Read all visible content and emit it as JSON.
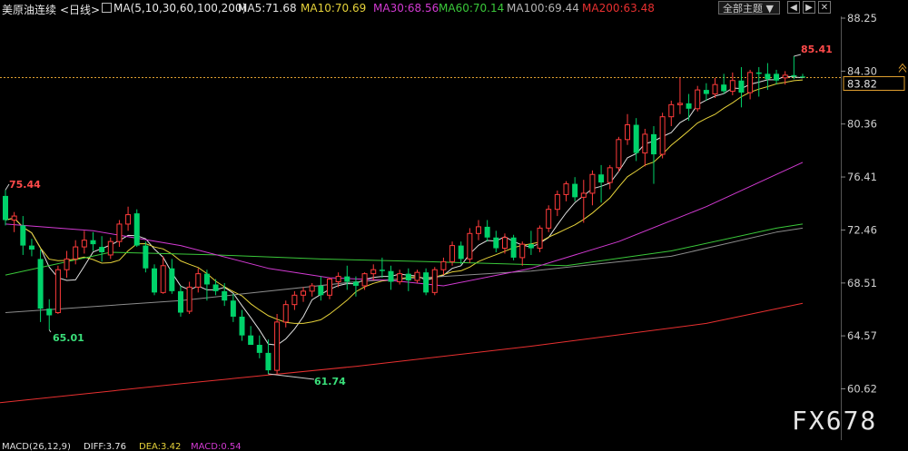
{
  "header": {
    "symbol": "美原油连续",
    "period": "<日线>",
    "indicator_name": "MA(5,10,30,60,100,200)",
    "ma5": "MA5:71.68",
    "ma10": "MA10:70.69",
    "ma30": "MA30:68.56",
    "ma60": "MA60:70.14",
    "ma100": "MA100:69.44",
    "ma200": "MA200:63.48",
    "theme_button": "全部主题 ▼",
    "btn_left": "◀",
    "btn_right": "▶",
    "btn_close": "✕"
  },
  "price_axis": {
    "ticks": [
      "88.25",
      "84.30",
      "80.36",
      "76.41",
      "72.46",
      "68.51",
      "64.57",
      "60.62"
    ],
    "current_price": "83.82"
  },
  "annotations": {
    "high_left": "75.44",
    "low_left": "65.01",
    "low_mid": "61.74",
    "high_right": "85.41"
  },
  "watermark": "FX678",
  "bottom": {
    "macd": "MACD(26,12,9)",
    "diff": "DIFF:3.76",
    "dea": "DEA:3.42",
    "macd_val": "MACD:0.54"
  },
  "colors": {
    "up": "#ff3b3b",
    "down": "#00d26a",
    "ma5": "#e0e0e0",
    "ma10": "#e6d23a",
    "ma30": "#d23ad2",
    "ma60": "#3ac83a",
    "ma100": "#8c8c8c",
    "ma200": "#e83030"
  },
  "chart_data": {
    "type": "candlestick",
    "y_ticks": [
      88.25,
      84.3,
      80.36,
      76.41,
      72.46,
      68.51,
      64.57,
      60.62
    ],
    "ylim": [
      59.8,
      88.8
    ],
    "current_price": 83.82,
    "candles": [
      [
        75.0,
        75.44,
        72.8,
        73.2
      ],
      [
        73.2,
        73.8,
        72.3,
        73.5
      ],
      [
        72.8,
        73.5,
        70.6,
        71.3
      ],
      [
        71.3,
        71.8,
        70.5,
        71.0
      ],
      [
        70.3,
        71.0,
        65.6,
        66.6
      ],
      [
        66.6,
        67.3,
        65.01,
        66.1
      ],
      [
        66.3,
        69.8,
        66.2,
        69.5
      ],
      [
        69.5,
        70.9,
        68.9,
        70.3
      ],
      [
        70.3,
        71.7,
        69.9,
        71.2
      ],
      [
        71.2,
        72.4,
        70.7,
        71.7
      ],
      [
        71.7,
        72.3,
        70.9,
        71.4
      ],
      [
        71.2,
        72.0,
        70.1,
        70.8
      ],
      [
        70.6,
        71.9,
        70.3,
        71.6
      ],
      [
        71.6,
        73.2,
        71.2,
        72.9
      ],
      [
        72.9,
        74.2,
        72.4,
        73.6
      ],
      [
        73.7,
        74.0,
        71.2,
        71.3
      ],
      [
        71.3,
        71.6,
        69.3,
        69.6
      ],
      [
        69.6,
        69.9,
        67.6,
        67.8
      ],
      [
        67.8,
        70.5,
        67.7,
        69.8
      ],
      [
        69.6,
        70.3,
        67.7,
        67.9
      ],
      [
        67.9,
        68.3,
        66.0,
        66.3
      ],
      [
        66.4,
        68.6,
        66.2,
        68.2
      ],
      [
        68.2,
        69.6,
        67.8,
        69.2
      ],
      [
        69.2,
        69.5,
        67.2,
        68.4
      ],
      [
        68.4,
        68.8,
        67.6,
        67.9
      ],
      [
        67.9,
        68.5,
        66.8,
        67.2
      ],
      [
        67.2,
        67.7,
        65.6,
        66.0
      ],
      [
        66.0,
        66.5,
        64.2,
        64.6
      ],
      [
        64.6,
        65.3,
        63.9,
        63.9
      ],
      [
        63.9,
        64.6,
        62.9,
        63.3
      ],
      [
        63.3,
        64.3,
        61.74,
        62.0
      ],
      [
        62.0,
        66.2,
        61.74,
        65.6
      ],
      [
        65.6,
        67.2,
        65.2,
        66.9
      ],
      [
        66.9,
        67.9,
        66.5,
        67.6
      ],
      [
        67.6,
        68.2,
        67.1,
        67.9
      ],
      [
        67.9,
        68.5,
        67.5,
        68.3
      ],
      [
        68.3,
        69.0,
        67.2,
        67.6
      ],
      [
        67.6,
        68.9,
        67.3,
        68.8
      ],
      [
        68.6,
        69.3,
        68.2,
        69.0
      ],
      [
        69.0,
        69.8,
        68.0,
        68.6
      ],
      [
        68.6,
        69.0,
        67.5,
        68.3
      ],
      [
        68.3,
        69.3,
        68.0,
        69.2
      ],
      [
        69.2,
        69.9,
        68.7,
        69.5
      ],
      [
        69.5,
        70.4,
        68.9,
        69.4
      ],
      [
        69.4,
        69.8,
        68.0,
        68.6
      ],
      [
        68.6,
        69.5,
        68.4,
        69.2
      ],
      [
        69.2,
        69.6,
        67.9,
        68.7
      ],
      [
        68.7,
        69.5,
        68.5,
        69.3
      ],
      [
        69.3,
        69.6,
        67.6,
        67.8
      ],
      [
        67.8,
        69.7,
        67.6,
        69.5
      ],
      [
        69.5,
        70.4,
        69.1,
        70.1
      ],
      [
        70.1,
        71.6,
        69.8,
        71.3
      ],
      [
        71.3,
        71.6,
        69.9,
        70.3
      ],
      [
        70.3,
        72.6,
        70.0,
        72.2
      ],
      [
        72.2,
        73.2,
        71.7,
        72.7
      ],
      [
        72.7,
        73.2,
        71.6,
        71.9
      ],
      [
        71.9,
        72.4,
        70.8,
        71.1
      ],
      [
        71.1,
        72.2,
        70.7,
        71.9
      ],
      [
        71.9,
        72.1,
        70.2,
        70.4
      ],
      [
        70.4,
        71.6,
        69.8,
        71.4
      ],
      [
        71.4,
        72.4,
        70.6,
        71.1
      ],
      [
        71.1,
        72.8,
        70.8,
        72.6
      ],
      [
        72.6,
        74.3,
        72.3,
        74.0
      ],
      [
        74.0,
        75.4,
        73.5,
        75.1
      ],
      [
        75.1,
        76.1,
        74.6,
        75.9
      ],
      [
        75.9,
        76.4,
        74.6,
        74.9
      ],
      [
        74.9,
        76.2,
        73.0,
        75.2
      ],
      [
        75.2,
        76.9,
        74.3,
        76.6
      ],
      [
        76.6,
        77.3,
        74.5,
        76.0
      ],
      [
        76.0,
        77.3,
        75.5,
        77.1
      ],
      [
        77.1,
        79.4,
        76.8,
        79.2
      ],
      [
        79.2,
        81.1,
        78.8,
        80.3
      ],
      [
        80.3,
        80.8,
        77.6,
        78.2
      ],
      [
        78.2,
        80.0,
        77.2,
        79.6
      ],
      [
        79.6,
        80.2,
        75.9,
        78.1
      ],
      [
        78.1,
        81.2,
        77.8,
        80.9
      ],
      [
        80.9,
        82.1,
        80.2,
        81.8
      ],
      [
        81.8,
        83.8,
        81.1,
        81.9
      ],
      [
        81.9,
        82.6,
        80.6,
        81.5
      ],
      [
        81.5,
        83.2,
        81.3,
        82.9
      ],
      [
        82.9,
        83.4,
        82.1,
        82.6
      ],
      [
        82.6,
        83.8,
        82.3,
        83.3
      ],
      [
        83.3,
        84.1,
        82.6,
        82.8
      ],
      [
        82.8,
        84.2,
        82.5,
        83.6
      ],
      [
        83.6,
        84.6,
        81.6,
        82.7
      ],
      [
        82.7,
        84.4,
        82.2,
        84.2
      ],
      [
        84.2,
        84.6,
        82.4,
        84.1
      ],
      [
        84.1,
        84.9,
        82.9,
        83.7
      ],
      [
        84.1,
        84.4,
        83.3,
        83.6
      ],
      [
        83.8,
        84.3,
        83.3,
        84.0
      ],
      [
        84.0,
        85.41,
        83.7,
        83.9
      ],
      [
        83.9,
        84.1,
        83.8,
        83.82
      ]
    ]
  }
}
